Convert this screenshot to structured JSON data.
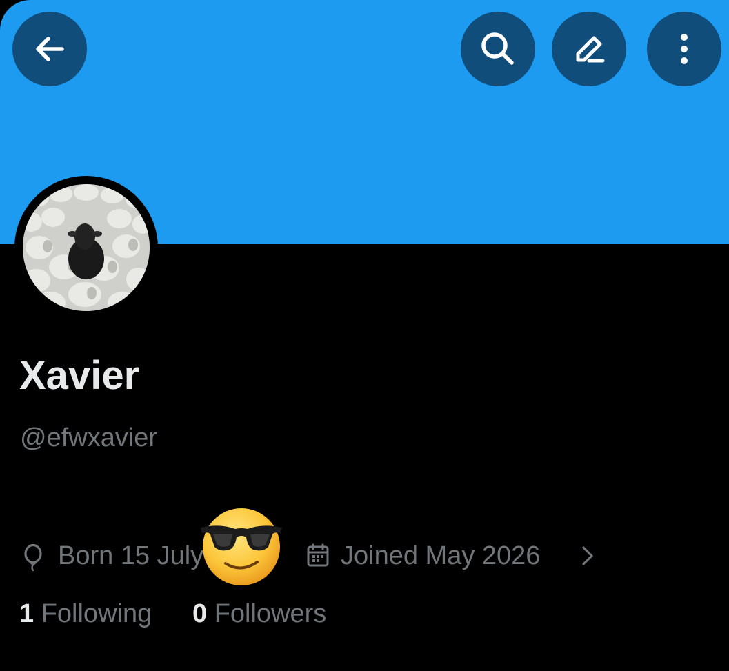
{
  "colors": {
    "banner": "#1D9BF0",
    "icon_button_bg": "#114D7B",
    "background": "#000000",
    "primary_text": "#E7E9EA",
    "secondary_text": "#71767B"
  },
  "header": {
    "buttons": [
      {
        "icon": "back-arrow-icon"
      },
      {
        "icon": "search-icon"
      },
      {
        "icon": "edit-icon"
      },
      {
        "icon": "more-vertical-icon"
      }
    ]
  },
  "profile": {
    "display_name": "Xavier",
    "handle": "@efwxavier",
    "born": "Born 15 July",
    "joined": "Joined May 2026",
    "avatar_icon": "sheep-flock-photo",
    "sticker_icon": "sunglasses-emoji"
  },
  "stats": {
    "following_count": "1",
    "following_label": "Following",
    "followers_count": "0",
    "followers_label": "Followers"
  }
}
